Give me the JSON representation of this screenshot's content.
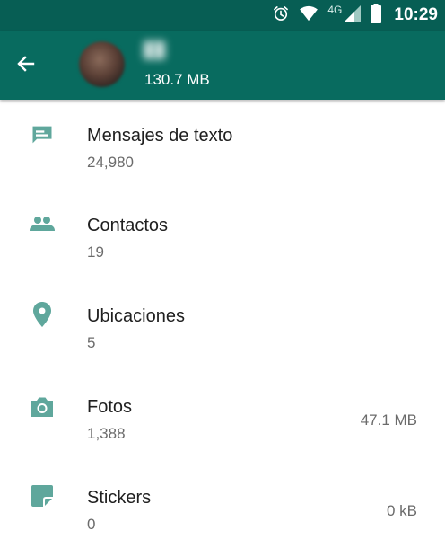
{
  "status_bar": {
    "time": "10:29",
    "network": "4G",
    "icons": [
      "alarm-icon",
      "wifi-icon",
      "cell-signal-icon",
      "battery-icon"
    ]
  },
  "header": {
    "total_size": "130.7 MB",
    "icons": [
      "back-arrow-icon",
      "avatar"
    ]
  },
  "items": [
    {
      "title": "Mensajes de texto",
      "count": "24,980",
      "size": "",
      "icon": "message-icon"
    },
    {
      "title": "Contactos",
      "count": "19",
      "size": "",
      "icon": "contacts-icon"
    },
    {
      "title": "Ubicaciones",
      "count": "5",
      "size": "",
      "icon": "location-pin-icon"
    },
    {
      "title": "Fotos",
      "count": "1,388",
      "size": "47.1 MB",
      "icon": "camera-icon"
    },
    {
      "title": "Stickers",
      "count": "0",
      "size": "0 kB",
      "icon": "sticker-icon"
    }
  ],
  "colors": {
    "status_bar": "#075e54",
    "app_bar": "#086b5f",
    "icon_tint": "#5fa79c"
  }
}
